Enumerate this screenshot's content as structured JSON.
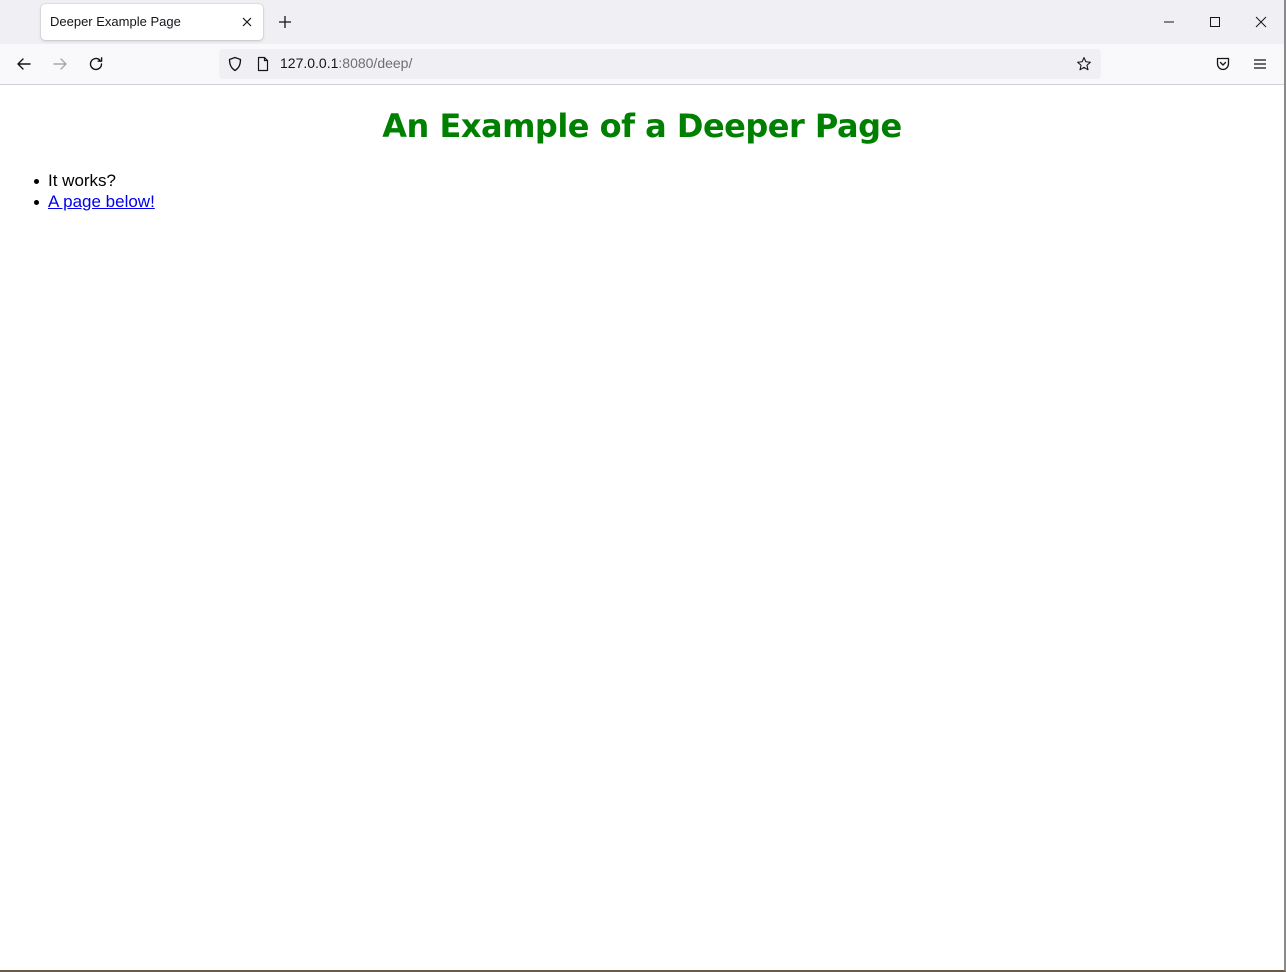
{
  "browser": {
    "tab": {
      "title": "Deeper Example Page"
    },
    "url": {
      "host": "127.0.0.1",
      "rest": ":8080/deep/"
    }
  },
  "page": {
    "title": "An Example of a Deeper Page",
    "items": [
      {
        "text": "It works?",
        "is_link": false
      },
      {
        "text": "A page below!",
        "is_link": true
      }
    ]
  },
  "colors": {
    "title": "#008000",
    "link": "#0000ee"
  }
}
